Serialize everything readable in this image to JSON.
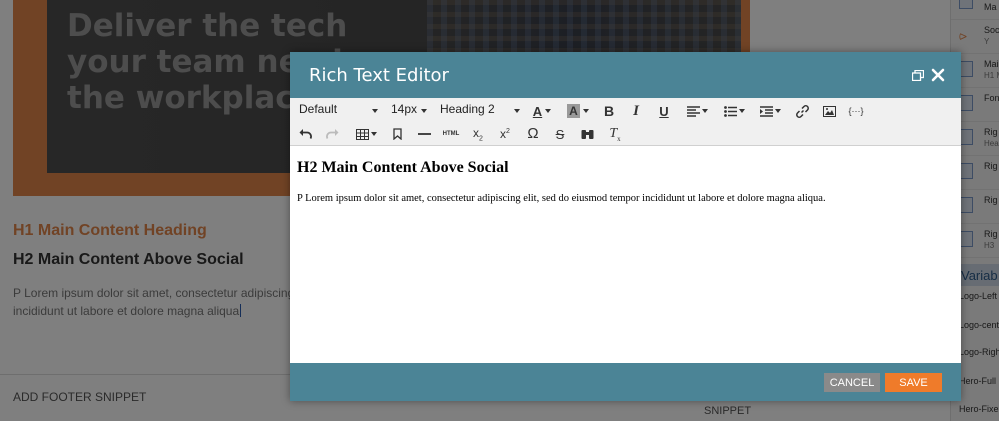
{
  "background": {
    "hero_lines": [
      "Deliver the tech",
      "your team needs",
      "the workplace."
    ],
    "h1": "H1 Main Content Heading",
    "h2": "H2 Main Content Above Social",
    "paragraph_line1": "P Lorem ipsum dolor sit amet, consectetur adipiscing",
    "paragraph_line2": "incididunt ut labore et dolore magna aliqua",
    "footer_snippet_label": "ADD FOOTER SNIPPET",
    "snippet_label": "SNIPPET"
  },
  "side_panel": {
    "items": [
      {
        "label": "Ma",
        "sub": ""
      },
      {
        "label": "Soc",
        "sub": "Y"
      },
      {
        "label": "Mai",
        "sub": "H1 M"
      },
      {
        "label": "Fon",
        "sub": ""
      },
      {
        "label": "Rig",
        "sub": "Hea"
      },
      {
        "label": "Rig",
        "sub": ""
      },
      {
        "label": "Rig",
        "sub": ""
      },
      {
        "label": "Rig",
        "sub": "H3"
      }
    ],
    "variables_label": "Variab",
    "variables": [
      "Logo-Left",
      "Logo-cent",
      "Logo-Righ",
      "Hero-Full",
      "Hero-Fixe"
    ]
  },
  "modal": {
    "title": "Rich Text Editor",
    "toolbar": {
      "font_family": "Default",
      "font_size": "14px",
      "format": "Heading 2",
      "html_label": "HTML",
      "omega": "Ω",
      "strike": "S",
      "clear_format": "T",
      "bold": "B",
      "italic": "I",
      "underline": "U",
      "text_color": "A",
      "bg_color": "A",
      "variable": "{···}",
      "subscript": "x",
      "superscript": "x"
    },
    "content": {
      "heading": "H2 Main Content Above Social",
      "paragraph": "P Lorem ipsum dolor sit amet, consectetur adipiscing elit, sed do eiusmod tempor incididunt ut labore et dolore magna aliqua."
    },
    "cancel_label": "CANCEL",
    "save_label": "SAVE"
  }
}
